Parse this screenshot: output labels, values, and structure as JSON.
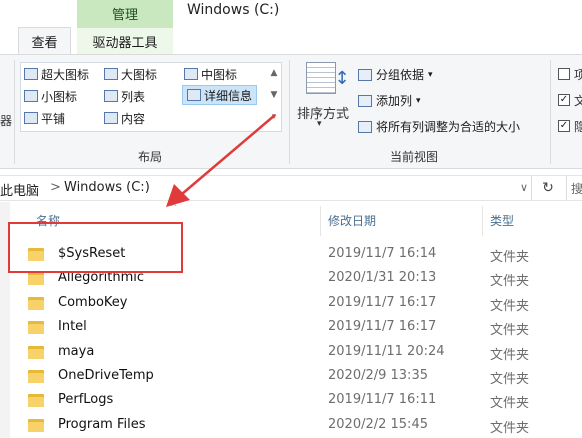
{
  "window": {
    "title": "Windows (C:)"
  },
  "ribbon": {
    "context_tab": "管理",
    "tabs": [
      "查看",
      "驱动器工具"
    ],
    "layout": {
      "items": [
        "超大图标",
        "大图标",
        "中图标",
        "小图标",
        "列表",
        "详细信息",
        "平铺",
        "内容"
      ],
      "selected": "详细信息",
      "group_label": "布局"
    },
    "current_view": {
      "sort_label": "排序方式",
      "group_by": "分组依据",
      "add_column": "添加列",
      "fit_columns": "将所有列调整为合适的大小",
      "group_label": "当前视图"
    },
    "checkboxes": [
      {
        "label": "项",
        "checked": false
      },
      {
        "label": "文",
        "checked": true
      },
      {
        "label": "隐",
        "checked": true
      }
    ],
    "left_fragment": "器"
  },
  "address": {
    "crumbs": [
      "此电脑",
      "Windows (C:)"
    ],
    "separator": ">",
    "dropdown_glyph": "∨",
    "refresh_glyph": "↻",
    "search_fragment": "搜"
  },
  "columns": {
    "name": "名称",
    "date": "修改日期",
    "type": "类型"
  },
  "files": [
    {
      "name": "$SysReset",
      "date": "2019/11/7 16:14",
      "type": "文件夹"
    },
    {
      "name": "Allegorithmic",
      "date": "2020/1/31 20:13",
      "type": "文件夹"
    },
    {
      "name": "ComboKey",
      "date": "2019/11/7 16:17",
      "type": "文件夹"
    },
    {
      "name": "Intel",
      "date": "2019/11/7 16:17",
      "type": "文件夹"
    },
    {
      "name": "maya",
      "date": "2019/11/11 20:24",
      "type": "文件夹"
    },
    {
      "name": "OneDriveTemp",
      "date": "2020/2/9 13:35",
      "type": "文件夹"
    },
    {
      "name": "PerfLogs",
      "date": "2019/11/7 16:11",
      "type": "文件夹"
    },
    {
      "name": "Program Files",
      "date": "2020/2/2 15:45",
      "type": "文件夹"
    }
  ],
  "colors": {
    "annotation": "#e03a3a",
    "context_tab": "#c9e8c0",
    "folder": "#f7d26a"
  }
}
